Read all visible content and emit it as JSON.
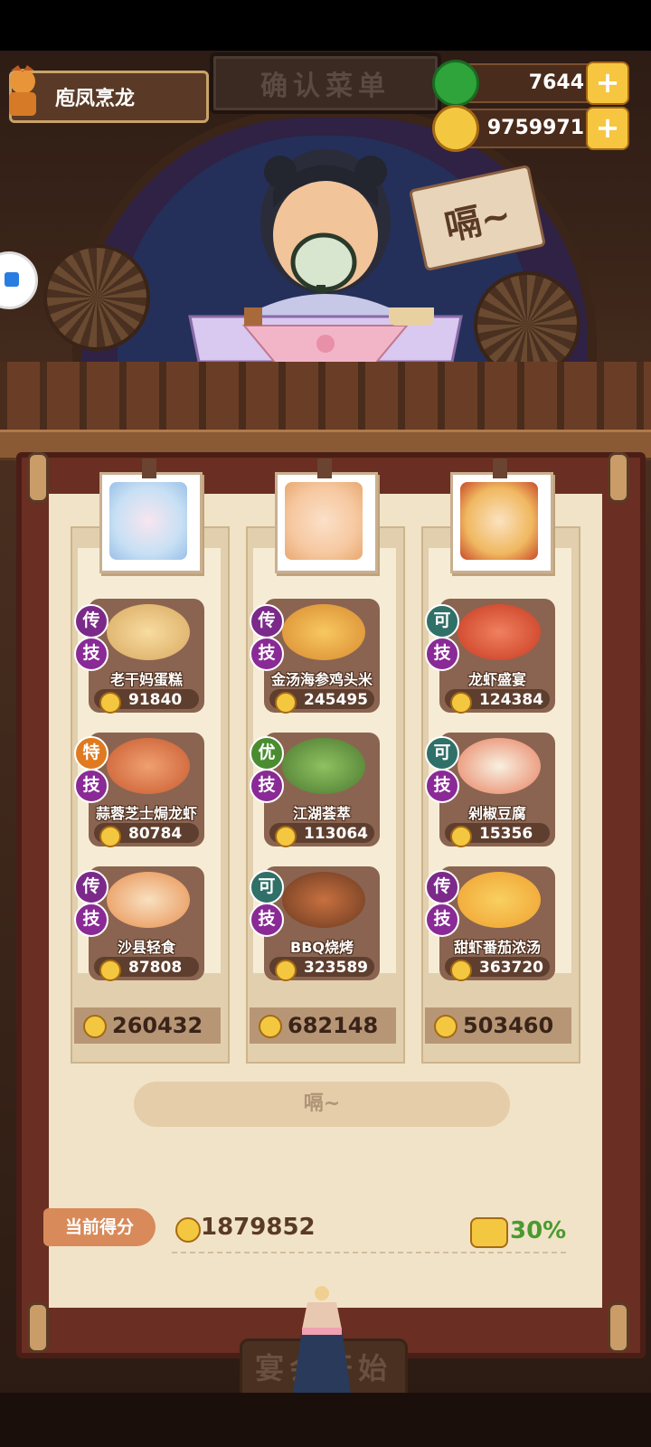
{
  "header": {
    "sign_text": "确认菜单",
    "player_name": "庖凤烹龙",
    "jade": "7644",
    "coins": "9759971",
    "plus_label": "+"
  },
  "speech_tag": "嗝~",
  "columns": [
    {
      "dishes": [
        {
          "grade": "传",
          "tech": "技",
          "name": "老干妈蛋糕",
          "price": "91840"
        },
        {
          "grade": "特",
          "tech": "技",
          "name": "蒜蓉芝士焗龙虾",
          "price": "80784"
        },
        {
          "grade": "传",
          "tech": "技",
          "name": "沙县轻食",
          "price": "87808"
        }
      ],
      "total": "260432"
    },
    {
      "dishes": [
        {
          "grade": "传",
          "tech": "技",
          "name": "金汤海参鸡头米",
          "price": "245495"
        },
        {
          "grade": "优",
          "tech": "技",
          "name": "江湖荟萃",
          "price": "113064"
        },
        {
          "grade": "可",
          "tech": "技",
          "name": "BBQ烧烤",
          "price": "323589"
        }
      ],
      "total": "682148"
    },
    {
      "dishes": [
        {
          "grade": "可",
          "tech": "技",
          "name": "龙虾盛宴",
          "price": "124384"
        },
        {
          "grade": "可",
          "tech": "技",
          "name": "剁椒豆腐",
          "price": "15356"
        },
        {
          "grade": "传",
          "tech": "技",
          "name": "甜虾番茄浓汤",
          "price": "363720"
        }
      ],
      "total": "503460"
    }
  ],
  "action_button": "嗝~",
  "score": {
    "label": "当前得分",
    "value": "1879852",
    "bonus": "30%"
  },
  "start_button": "宴会开始",
  "colors": {
    "legend": "#7b2a8a",
    "special": "#e07a20",
    "good": "#4a8c30",
    "ok": "#2f7068",
    "bonus": "#4a9a30"
  }
}
